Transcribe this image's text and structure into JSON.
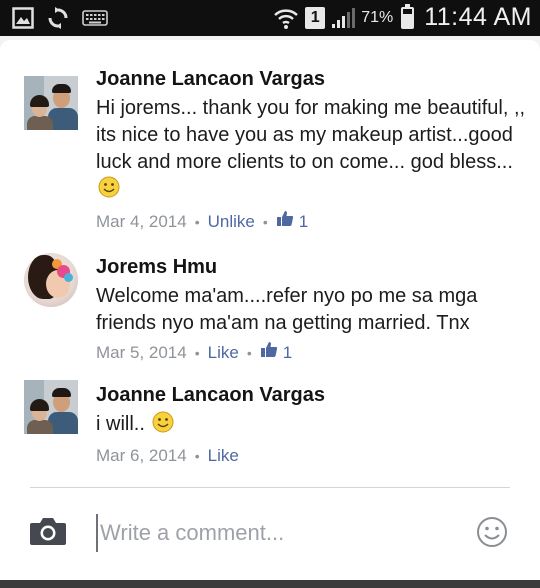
{
  "status_bar": {
    "left_icons": [
      "gallery-icon",
      "sync-icon",
      "keyboard-icon"
    ],
    "sim_label": "1",
    "battery_percent": "71%",
    "battery_level": 0.71,
    "time": "11:44 AM"
  },
  "comments": [
    {
      "author": "Joanne Lancaon Vargas",
      "text": "Hi jorems... thank you for making me beautiful, ,, its nice to have you as my makeup artist...good luck and more clients to on come... god bless...",
      "has_emoji": true,
      "date": "Mar 4, 2014",
      "action": "Unlike",
      "like_count": "1"
    },
    {
      "author": "Jorems Hmu",
      "text": "Welcome ma'am....refer nyo po me sa mga friends nyo ma'am na getting married. Tnx",
      "has_emoji": false,
      "date": "Mar 5, 2014",
      "action": "Like",
      "like_count": "1"
    },
    {
      "author": "Joanne Lancaon Vargas",
      "text": "i will..",
      "has_emoji": true,
      "date": "Mar 6, 2014",
      "action": "Like"
    }
  ],
  "composer": {
    "placeholder": "Write a comment...",
    "camera_icon": "camera-icon",
    "emoji_icon": "smiley-icon"
  },
  "colors": {
    "link": "#4e69a2",
    "meta": "#8f949b",
    "status_bar": "#0f0f0f"
  }
}
